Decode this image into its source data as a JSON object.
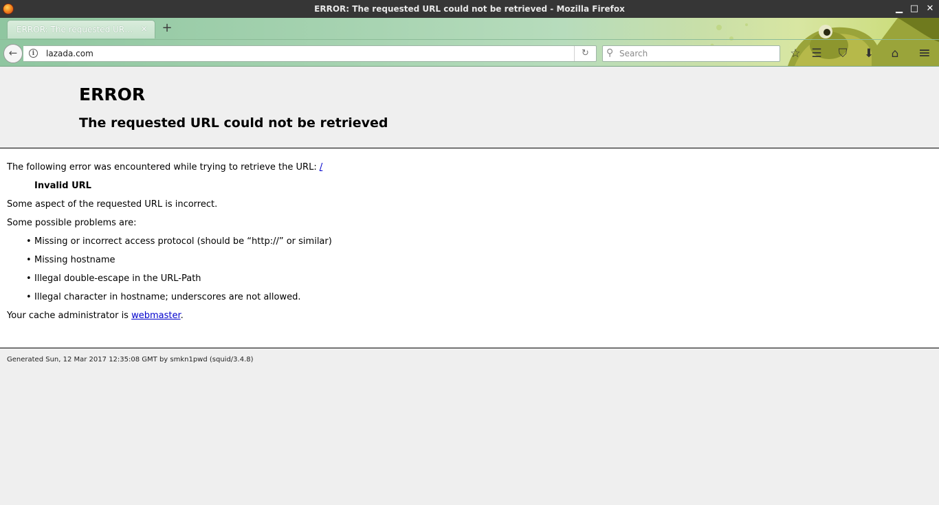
{
  "window": {
    "title": "ERROR: The requested URL could not be retrieved - Mozilla Firefox",
    "minimize": "▁",
    "maximize": "□",
    "close": "✕"
  },
  "tab": {
    "label": "ERROR: The requested URL c...",
    "close": "×",
    "new_tab": "+"
  },
  "navbar": {
    "back": "←",
    "url": "lazada.com",
    "info": "i",
    "reload": "↻",
    "search_placeholder": "Search",
    "search_icon": "⚲",
    "icons": {
      "bookmark": "☆",
      "library": "☰",
      "pocket": "⛉",
      "download": "⬇",
      "home": "⌂",
      "menu": "≡"
    }
  },
  "page": {
    "heading": "ERROR",
    "subheading": "The requested URL could not be retrieved",
    "intro": "The following error was encountered while trying to retrieve the URL: ",
    "intro_link": "/",
    "error_name": "Invalid URL",
    "aspect": "Some aspect of the requested URL is incorrect.",
    "problems_intro": "Some possible problems are:",
    "problems": [
      "Missing or incorrect access protocol (should be “http://” or similar)",
      "Missing hostname",
      "Illegal double-escape in the URL-Path",
      "Illegal character in hostname; underscores are not allowed."
    ],
    "admin_prefix": "Your cache administrator is ",
    "admin_link": "webmaster",
    "admin_suffix": ".",
    "footer": "Generated Sun, 12 Mar 2017 12:35:08 GMT by smkn1pwd (squid/3.4.8)"
  }
}
